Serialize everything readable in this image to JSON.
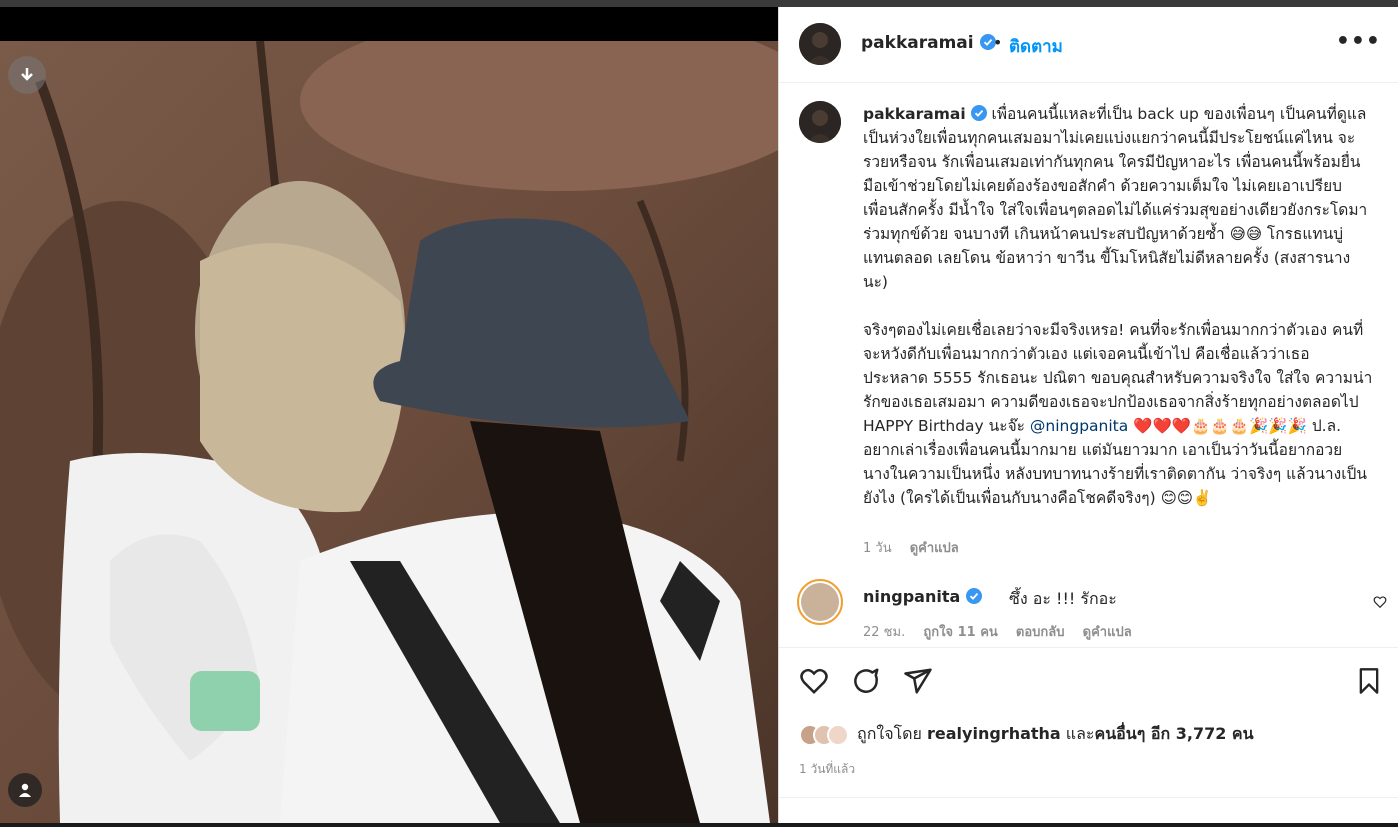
{
  "post": {
    "username": "pakkaramai",
    "dot": "•",
    "follow_label": "ติดตาม",
    "more_label": "•••"
  },
  "caption": {
    "username": "pakkaramai",
    "body": "เพื่อนคนนี้แหละที่เป็น back up ของเพื่อนๆ เป็นคนที่ดูแลเป็นห่วงใยเพื่อนทุกคนเสมอมาไม่เคยแบ่งแยกว่าคนนี้มีประโยชน์แค่ไหน จะรวยหรือจน รักเพื่อนเสมอเท่ากันทุกคน ใครมีปัญหาอะไร เพื่อนคนนี้พร้อมยื่นมือเข้าช่วยโดยไม่เคยต้องร้องขอสักคำ ด้วยความเต็มใจ ไม่เคยเอาเปรียบเพื่อนสักครั้ง มีน้ำใจ ใส่ใจเพื่อนๆตลอดไม่ได้แค่ร่วมสุขอย่างเดียวยังกระโดมาร่วมทุกข์ด้วย จนบางที เกินหน้าคนประสบปัญหาด้วยซ้ำ 😅😅 โกรธแทนบู่แทนตลอด เลยโดน ข้อหาว่า ขาวีน ขี้โมโหนิสัยไม่ดีหลายครั้ง (สงสารนางนะ)\n\nจริงๆตองไม่เคยเชื่อเลยว่าจะมีจริงเหรอ! คนที่จะรักเพื่อนมากกว่าตัวเอง คนที่จะหวังดีกับเพื่อนมากกว่าตัวเอง แต่เจอคนนี้เข้าไป คือเชื่อแล้วว่าเธอประหลาด 5555 รักเธอนะ ปณิตา ขอบคุณสำหรับความจริงใจ ใส่ใจ ความน่ารักของเธอเสมอมา ความดีของเธอจะปกป้องเธอจากสิ่งร้ายทุกอย่างตลอดไป HAPPY Birthday นะจ๊ะ ",
    "mention": "@ningpanita",
    "body_end": " ❤️❤️❤️🎂🎂🎂🎉🎉🎉 ป.ล. อยากเล่าเรื่องเพื่อนคนนี้มากมาย แต่มันยาวมาก เอาเป็นว่าวันนี้อยากอวยนางในความเป็นหนึ่ง หลังบทบาทนางร้ายที่เราติดตากัน ว่าจริงๆ แล้วนางเป็นยังไง (ใครได้เป็นเพื่อนกับนางคือโชคดีจริงๆ) 😊😊✌️",
    "time": "1 วัน",
    "translate": "ดูคำแปล"
  },
  "comment": {
    "username": "ningpanita",
    "text": "ซึ้ง อะ !!! รักอะ",
    "time": "22 ชม.",
    "likes": "ถูกใจ 11 คน",
    "reply": "ตอบกลับ",
    "translate": "ดูคำแปล"
  },
  "likes": {
    "prefix": "ถูกใจโดย ",
    "user": "realyingrhatha",
    "middle": " และ",
    "others": "คนอื่นๆ อีก 3,772 คน"
  },
  "time_ago": "1 วันที่แล้ว",
  "colors": {
    "link": "#0095f6",
    "mention": "#00376b",
    "muted": "#8e8e8e",
    "verified": "#3897f0"
  },
  "icons": [
    "download-icon",
    "user-tag-icon",
    "verified-icon",
    "more-icon",
    "heart-icon",
    "comment-icon",
    "share-icon",
    "bookmark-icon"
  ]
}
